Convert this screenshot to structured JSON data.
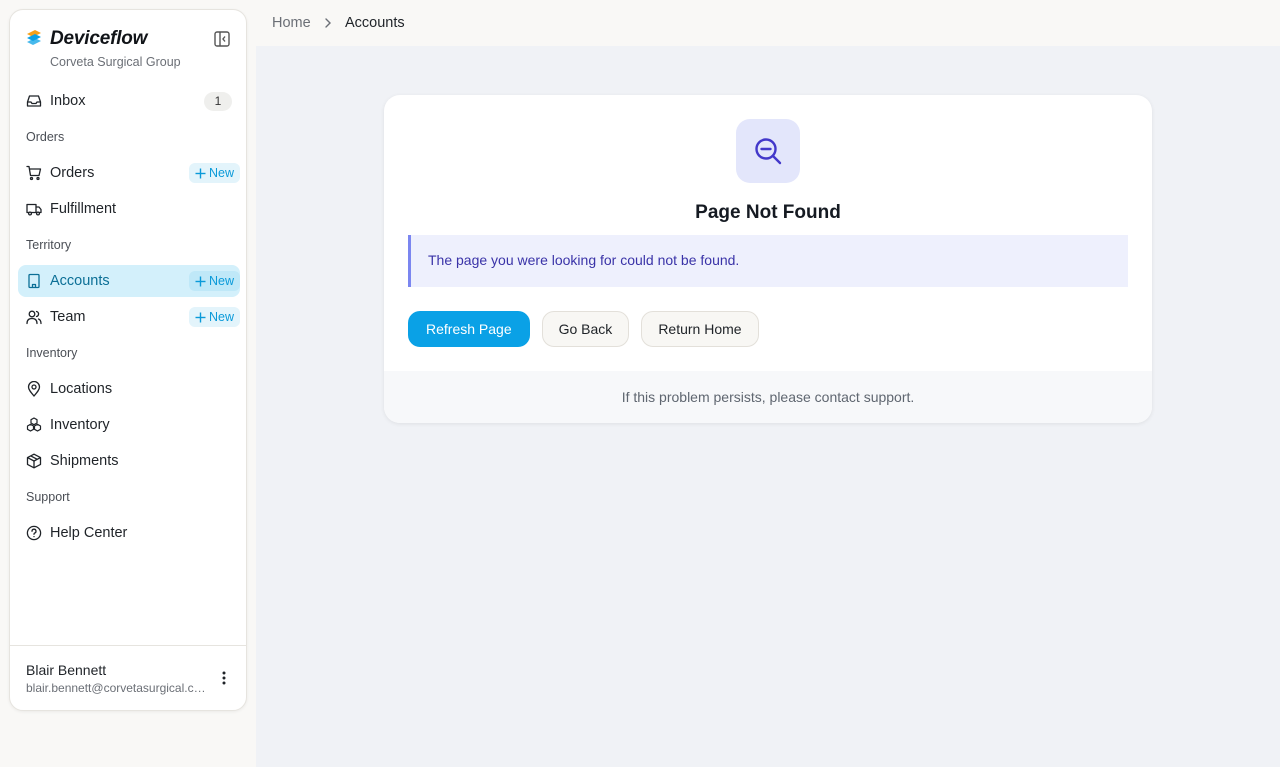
{
  "brand": {
    "name": "Deviceflow",
    "org": "Corveta Surgical Group"
  },
  "sidebar": {
    "inbox": {
      "label": "Inbox",
      "count": "1",
      "icon": "inbox-icon"
    },
    "sections": [
      {
        "label": "Orders",
        "items": [
          {
            "label": "Orders",
            "icon": "shopping-cart-icon",
            "new": "New"
          },
          {
            "label": "Fulfillment",
            "icon": "truck-icon"
          }
        ]
      },
      {
        "label": "Territory",
        "items": [
          {
            "label": "Accounts",
            "icon": "building-icon",
            "new": "New",
            "active": true
          },
          {
            "label": "Team",
            "icon": "users-icon",
            "new": "New"
          }
        ]
      },
      {
        "label": "Inventory",
        "items": [
          {
            "label": "Locations",
            "icon": "map-pin-icon"
          },
          {
            "label": "Inventory",
            "icon": "boxes-icon"
          },
          {
            "label": "Shipments",
            "icon": "package-icon"
          }
        ]
      },
      {
        "label": "Support",
        "items": [
          {
            "label": "Help Center",
            "icon": "help-circle-icon"
          }
        ]
      }
    ]
  },
  "user": {
    "name": "Blair Bennett",
    "email": "blair.bennett@corvetasurgical.com"
  },
  "breadcrumb": {
    "home": "Home",
    "current": "Accounts"
  },
  "error": {
    "title": "Page Not Found",
    "message": "The page you were looking for could not be found.",
    "buttons": {
      "refresh": "Refresh Page",
      "back": "Go Back",
      "home": "Return Home"
    },
    "footer": "If this problem persists, please contact support."
  },
  "colors": {
    "accent": "#0aa1e6",
    "active_bg": "#d3f0fb",
    "alert_text": "#3a33a8",
    "icon_accent": "#4338ca"
  }
}
